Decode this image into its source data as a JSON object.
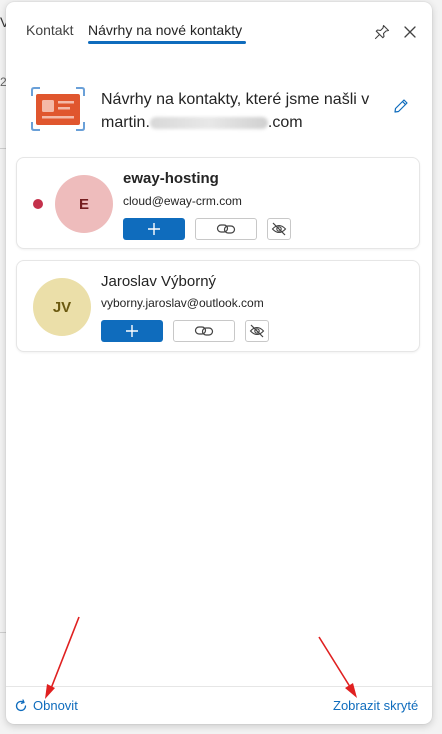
{
  "background": {
    "edge_glyph": "V",
    "edge_glyph2": "2"
  },
  "tabs": [
    {
      "label": "Kontakt",
      "active": false
    },
    {
      "label": "Návrhy na nové kontakty",
      "active": true
    }
  ],
  "header_actions": {
    "pin_icon": "pin-icon",
    "close_icon": "close-icon"
  },
  "header": {
    "icon": "contact-card-icon",
    "text_line1": "Návrhy na kontakty, které jsme našli v",
    "text_line2_prefix": "martin.",
    "text_line2_suffix": ".com",
    "edit_icon": "pencil-icon"
  },
  "suggestions": [
    {
      "name": "eway-hosting",
      "email": "cloud@eway-crm.com",
      "initials": "E",
      "avatar_color": "#eebcbc",
      "initials_color": "#751d1f",
      "unread_dot": true,
      "bold_name": true
    },
    {
      "name": "Jaroslav Výborný",
      "email": "vyborny.jaroslav@outlook.com",
      "initials": "JV",
      "avatar_color": "#ebdfa9",
      "initials_color": "#6b5a10",
      "unread_dot": false,
      "bold_name": false
    }
  ],
  "footer": {
    "refresh_label": "Obnovit",
    "show_hidden_label": "Zobrazit skryté"
  },
  "colors": {
    "accent": "#0f6cbd",
    "annotation_arrow": "#e02020",
    "unread_dot": "#c4314b"
  }
}
